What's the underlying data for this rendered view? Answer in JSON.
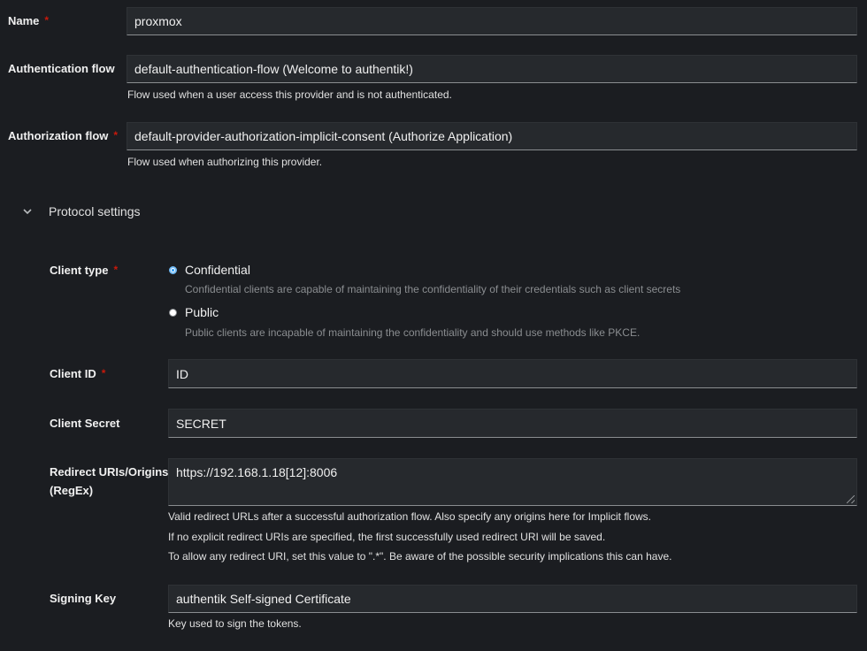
{
  "name": {
    "label": "Name",
    "required": "*",
    "value": "proxmox"
  },
  "authentication_flow": {
    "label": "Authentication flow",
    "value": "default-authentication-flow (Welcome to authentik!)",
    "helper": "Flow used when a user access this provider and is not authenticated."
  },
  "authorization_flow": {
    "label": "Authorization flow",
    "required": "*",
    "value": "default-provider-authorization-implicit-consent (Authorize Application)",
    "helper": "Flow used when authorizing this provider."
  },
  "protocol_settings": {
    "title": "Protocol settings",
    "expanded_icon": "chevron-down-icon",
    "client_type": {
      "label": "Client type",
      "required": "*",
      "options": [
        {
          "label": "Confidential",
          "description": "Confidential clients are capable of maintaining the confidentiality of their credentials such as client secrets",
          "checked": true
        },
        {
          "label": "Public",
          "description": "Public clients are incapable of maintaining the confidentiality and should use methods like PKCE.",
          "checked": false
        }
      ]
    },
    "client_id": {
      "label": "Client ID",
      "required": "*",
      "value": "ID"
    },
    "client_secret": {
      "label": "Client Secret",
      "value": "SECRET"
    },
    "redirect_uris": {
      "label_line1": "Redirect URIs/Origins",
      "label_line2": "(RegEx)",
      "value": "https://192.168.1.18[12]:8006",
      "helper_lines": [
        "Valid redirect URLs after a successful authorization flow. Also specify any origins here for Implicit flows.",
        "If no explicit redirect URIs are specified, the first successfully used redirect URI will be saved.",
        "To allow any redirect URI, set this value to \".*\". Be aware of the possible security implications this can have."
      ]
    },
    "signing_key": {
      "label": "Signing Key",
      "value": "authentik Self-signed Certificate",
      "helper": "Key used to sign the tokens."
    }
  },
  "colors": {
    "background": "#1b1d21",
    "field_background": "#26292d",
    "required": "#c9190b",
    "radio_accent": "#2b9af3"
  }
}
